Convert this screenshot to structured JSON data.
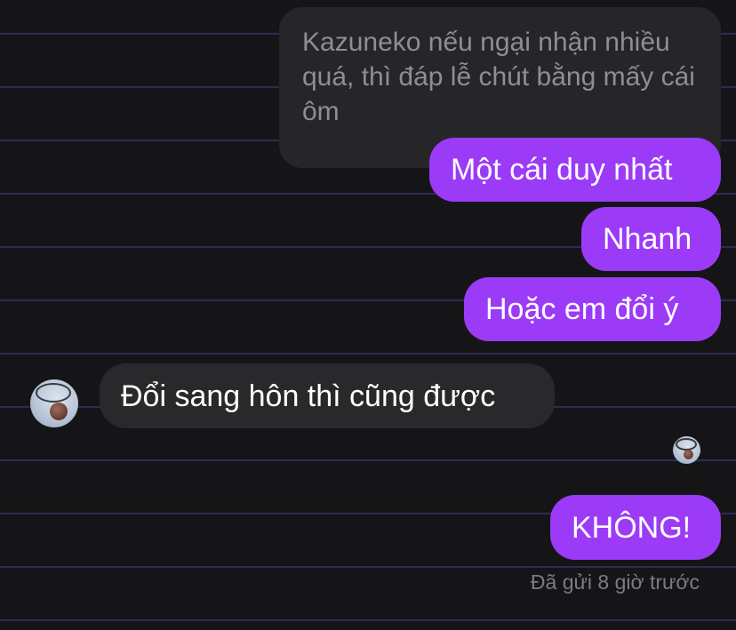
{
  "messages": {
    "reply_preview": "Kazuneko nếu ngại nhận nhiều quá, thì đáp lễ chút bằng mấy cái ôm",
    "out_1": "Một cái duy nhất",
    "out_2": "Nhanh",
    "out_3": "Hoặc em đổi ý",
    "in_1": "Đổi sang hôn thì cũng được",
    "out_4": "KHÔNG!"
  },
  "status": {
    "sent_text": "Đã gửi 8 giờ trước"
  },
  "icons": {
    "contact_avatar": "basketball-hoop-avatar",
    "read_receipt": "seen-avatar"
  },
  "colors": {
    "outgoing_bubble": "#9b3bf7",
    "incoming_bubble": "#29292c",
    "background": "#151517",
    "lines": "#2e2a55"
  }
}
